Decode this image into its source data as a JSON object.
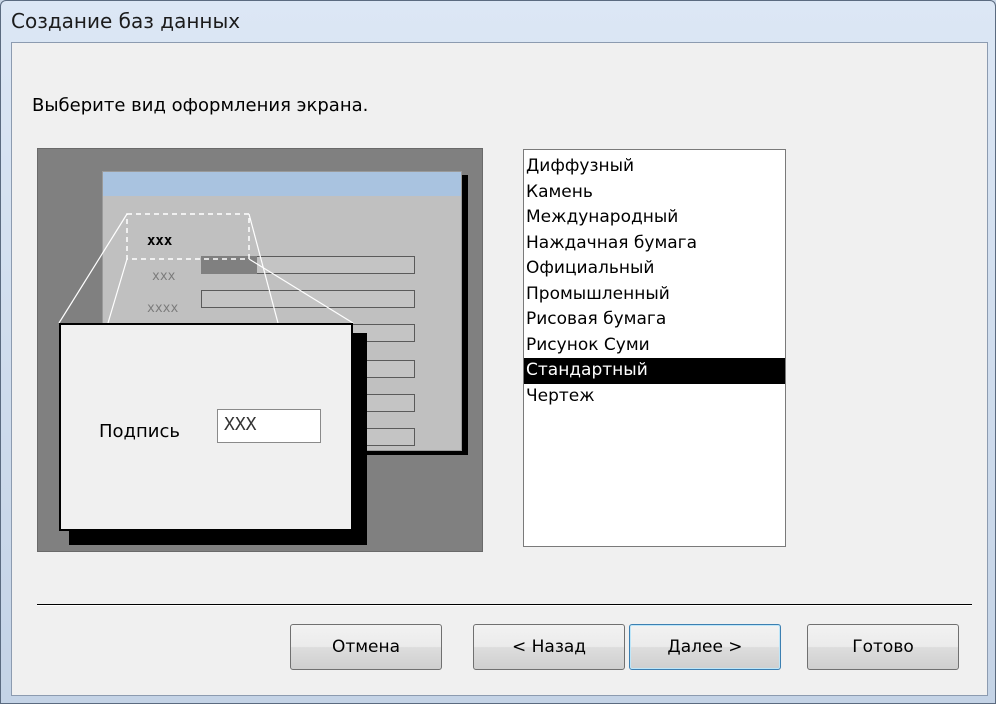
{
  "window": {
    "title": "Создание баз данных"
  },
  "prompt": "Выберите вид оформления экрана.",
  "preview": {
    "mock_labels": [
      "xxx",
      "xxx",
      "xxxx"
    ],
    "caption": "Подпись",
    "field_value": "XXX"
  },
  "styles": {
    "items": [
      "Диффузный",
      "Камень",
      "Международный",
      "Наждачная бумага",
      "Официальный",
      "Промышленный",
      "Рисовая бумага",
      "Рисунок Суми",
      "Стандартный",
      "Чертеж"
    ],
    "selected": "Стандартный"
  },
  "buttons": {
    "cancel": "Отмена",
    "back": "< Назад",
    "next": "Далее >",
    "finish": "Готово"
  },
  "colors": {
    "selection": "#000000",
    "preview_bg": "#808080",
    "mock_header": "#a9c3e0"
  }
}
